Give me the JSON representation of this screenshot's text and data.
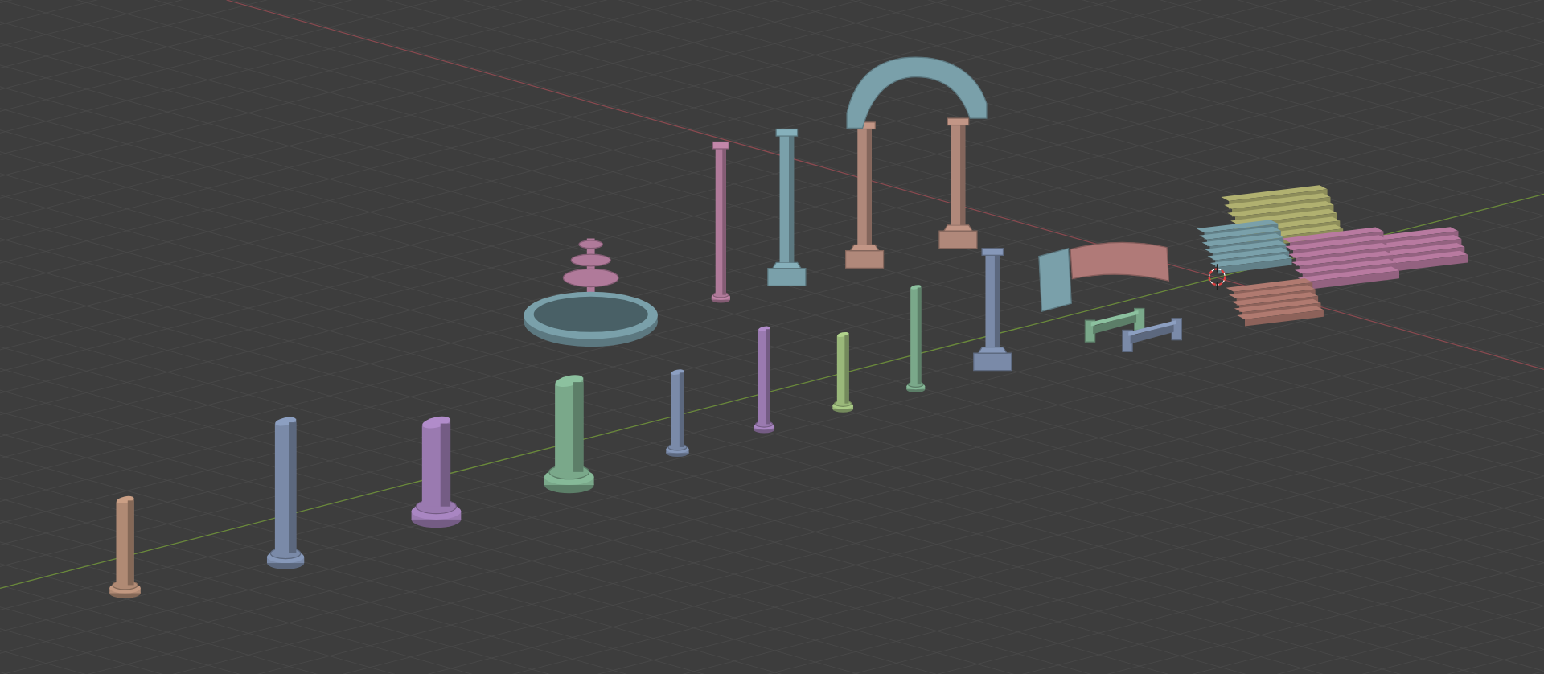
{
  "viewport": {
    "objects": [
      {
        "kind": "broken_column",
        "color": "#b08a74"
      },
      {
        "kind": "broken_column",
        "color": "#7a8aa8"
      },
      {
        "kind": "broken_column",
        "color": "#9a7ab0"
      },
      {
        "kind": "broken_column",
        "color": "#7aa88a"
      },
      {
        "kind": "broken_column",
        "color": "#7a8aa8"
      },
      {
        "kind": "broken_column",
        "color": "#9a7ab0"
      },
      {
        "kind": "broken_column",
        "color": "#9ab87a"
      },
      {
        "kind": "broken_column",
        "color": "#7aa88a"
      },
      {
        "kind": "pedestal_column",
        "color": "#7a8aa8"
      },
      {
        "kind": "fountain_basin",
        "color": "#7aa0aa"
      },
      {
        "kind": "fountain_tiers",
        "color": "#b07a9a"
      },
      {
        "kind": "column",
        "color": "#b07a9a"
      },
      {
        "kind": "pedestal_column",
        "color": "#7aa0aa"
      },
      {
        "kind": "arch_columns",
        "color": "#b0887a"
      },
      {
        "kind": "arch_top",
        "color": "#7aa0aa"
      },
      {
        "kind": "wall",
        "color": "#7aa0aa"
      },
      {
        "kind": "curved_wall",
        "color": "#b07a78"
      },
      {
        "kind": "fence",
        "color": "#7aa88a"
      },
      {
        "kind": "fence",
        "color": "#7a8aa8"
      },
      {
        "kind": "stairs",
        "color": "#b0b070"
      },
      {
        "kind": "stairs",
        "color": "#7aa0aa"
      },
      {
        "kind": "stairs",
        "color": "#b87aa0"
      },
      {
        "kind": "stairs",
        "color": "#b87aa0"
      },
      {
        "kind": "stairs",
        "color": "#b07a70"
      }
    ]
  }
}
